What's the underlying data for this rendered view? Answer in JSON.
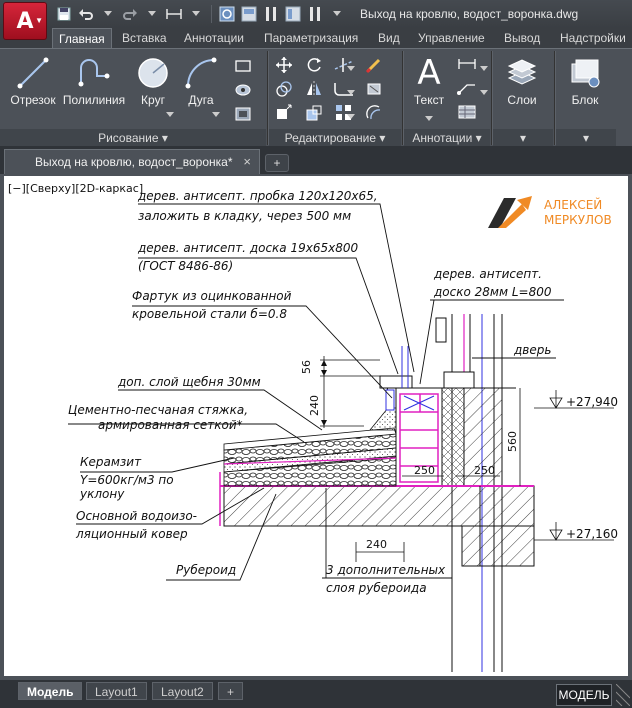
{
  "window": {
    "title": "Выход на кровлю, водост_воронка.dwg"
  },
  "ribbon_tabs": [
    "Главная",
    "Вставка",
    "Аннотации",
    "Параметризация",
    "Вид",
    "Управление",
    "Вывод",
    "Надстройки"
  ],
  "tools": {
    "line": "Отрезок",
    "polyline": "Полилиния",
    "circle": "Круг",
    "arc": "Дуга",
    "text": "Текст",
    "layers": "Слои",
    "block": "Блок"
  },
  "panels": {
    "draw": "Рисование ▾",
    "modify": "Редактирование ▾",
    "annotation": "Аннотации ▾",
    "layers": "▾",
    "block": "▾"
  },
  "document_tab": {
    "label": "Выход на кровлю, водост_воронка*",
    "close": "×",
    "new": "+"
  },
  "viewport_label": "[−][Сверху][2D-каркас]",
  "logo": {
    "line1": "АЛЕКСЕЙ",
    "line2": "МЕРКУЛОВ"
  },
  "drawing_notes": {
    "n1a": "дерев. антисепт. пробка 120х120х65,",
    "n1b": "заложить в кладку, через 500 мм",
    "n2a": "дерев. антисепт. доска 19х65х800",
    "n2b": "(ГОСТ 8486-86)",
    "n3a": "Фартук из оцинкованной",
    "n3b": "кровельной стали б=0.8",
    "n4a": "дерев. антисепт.",
    "n4b": "доско 28мм L=800",
    "n5": "дверь",
    "n6": "доп. слой щебня 30мм",
    "n7a": "Цементно-песчаная стяжка,",
    "n7b": "армированная сеткой*",
    "n8": "Керамзит",
    "n9a": "Y=600кг/м3 по",
    "n9b": "уклону",
    "n10a": "Основной водоизо-",
    "n10b": "ляционный ковер",
    "n11": "Рубероид",
    "n12a": "3 дополнительных",
    "n12b": "слоя рубероида"
  },
  "dimensions": {
    "d56": "56",
    "d240a": "240",
    "d250a": "250",
    "d250b": "250",
    "d560": "560",
    "d240b": "240",
    "lvl1": "+27,940",
    "lvl2": "+27,160"
  },
  "layout_tabs": {
    "model": "Модель",
    "layout1": "Layout1",
    "layout2": "Layout2",
    "add": "+"
  },
  "status": {
    "mode": "МОДЕЛЬ"
  },
  "colors": {
    "accent_red": "#c8102e",
    "logo_orange": "#f08a24",
    "wall_magenta": "#e020c0",
    "insulation_blue": "#3030e0"
  }
}
